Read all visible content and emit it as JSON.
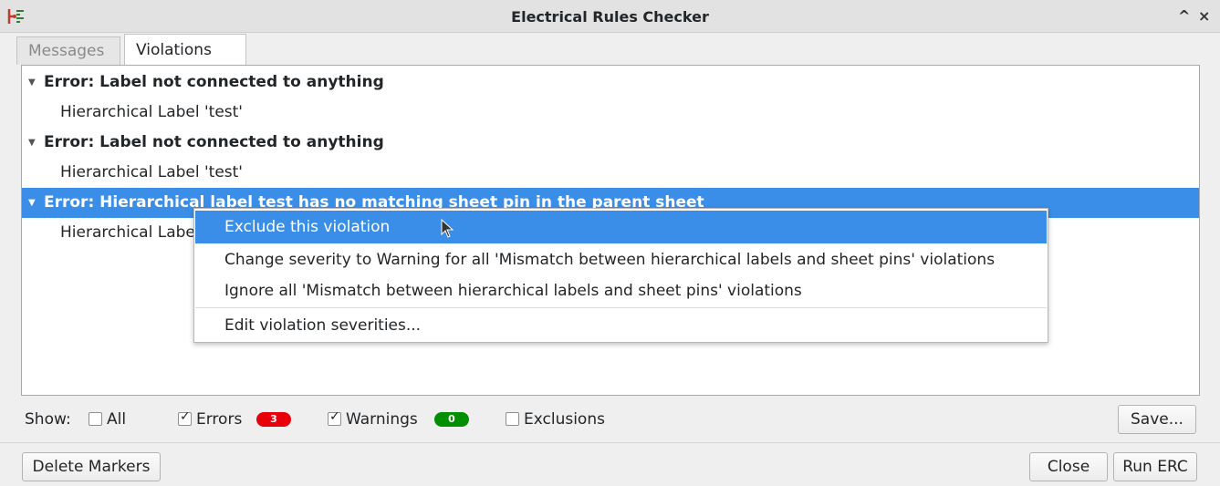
{
  "window": {
    "title": "Electrical Rules Checker",
    "collapse_glyph": "^",
    "close_glyph": "×"
  },
  "tabs": [
    {
      "label": "Messages",
      "active": false
    },
    {
      "label": "Violations",
      "active": true
    }
  ],
  "violations": [
    {
      "title": "Error: Label not connected to anything",
      "item": "Hierarchical Label 'test'"
    },
    {
      "title": "Error: Label not connected to anything",
      "item": "Hierarchical Label 'test'"
    },
    {
      "title": "Error: Hierarchical label test has no matching sheet pin in the parent sheet",
      "item": "Hierarchical Label 'test'",
      "selected": true
    }
  ],
  "context_menu": {
    "items": [
      "Exclude this violation",
      "Change severity to Warning for all 'Mismatch between hierarchical labels and sheet pins' violations",
      "Ignore all 'Mismatch between hierarchical labels and sheet pins' violations",
      "Edit violation severities..."
    ],
    "hovered_index": 0
  },
  "filters": {
    "show_label": "Show:",
    "all": {
      "label": "All",
      "checked": false
    },
    "errors": {
      "label": "Errors",
      "checked": true,
      "count": "3",
      "color": "#e8000b"
    },
    "warnings": {
      "label": "Warnings",
      "checked": true,
      "count": "0",
      "color": "#008f00"
    },
    "exclusions": {
      "label": "Exclusions",
      "checked": false
    },
    "save_label": "Save..."
  },
  "buttons": {
    "delete_markers": "Delete Markers",
    "close": "Close",
    "run_erc": "Run ERC"
  },
  "colors": {
    "selection": "#3b8ee8"
  },
  "icons": {
    "app": "kicad-eeschema-icon",
    "expand": "triangle-down-icon",
    "cursor": "mouse-pointer-icon"
  }
}
